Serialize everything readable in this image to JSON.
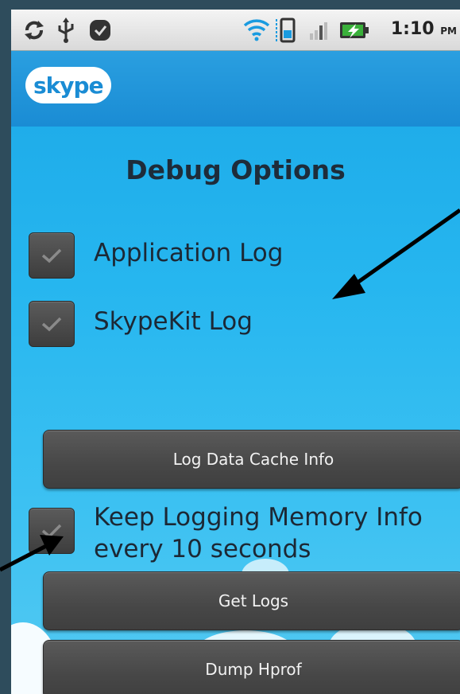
{
  "status_bar": {
    "time": "1:10",
    "ampm": "PM",
    "icons": [
      "sync-icon",
      "usb-icon",
      "notification-icon",
      "wifi-icon",
      "sim-icon",
      "signal-icon",
      "battery-icon"
    ]
  },
  "app_bar": {
    "logo_text": "skype"
  },
  "page": {
    "title": "Debug Options"
  },
  "options": {
    "application_log": {
      "label": "Application Log",
      "checked": true
    },
    "skypekit_log": {
      "label": "SkypeKit Log",
      "checked": true
    },
    "keep_logging": {
      "label_line1": "Keep Logging Memory Info",
      "label_line2": "every 10 seconds",
      "checked": true
    }
  },
  "buttons": {
    "log_data_cache": "Log Data Cache Info",
    "get_logs": "Get Logs",
    "dump_hprof": "Dump Hprof"
  },
  "colors": {
    "background": "#26b6ef",
    "button": "#474747",
    "checkbox": "#4a4a4a",
    "text": "#1c2835"
  }
}
